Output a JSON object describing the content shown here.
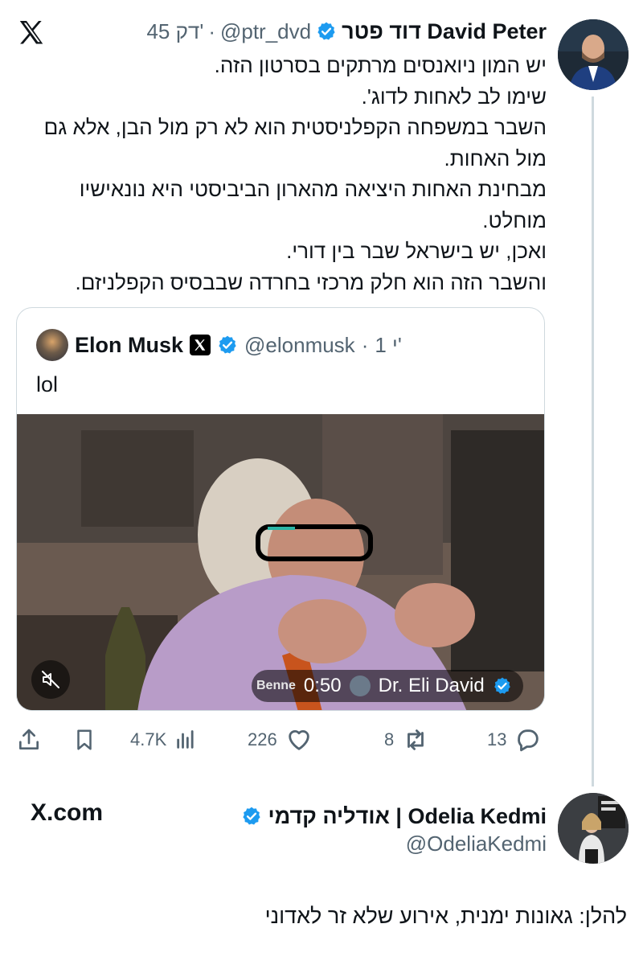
{
  "top_tweet": {
    "author_name": "דוד פטר David Peter",
    "handle": "@ptr_dvd",
    "separator": "·",
    "time": "45 דק'",
    "lines": [
      "יש המון ניואנסים מרתקים בסרטון הזה.",
      "שימו לב לאחות לדוג'.",
      "השבר במשפחה הקפלניסטית הוא לא רק מול הבן, אלא גם מול האחות.",
      "מבחינת  האחות היציאה מהארון הביביסטי היא נונאישיו מוחלט.",
      "ואכן, יש בישראל שבר בין דורי.",
      "והשבר הזה הוא חלק מרכזי בחרדה שבבסיס הקפלניזם."
    ]
  },
  "quoted_tweet": {
    "author_name": "Elon Musk",
    "handle": "@elonmusk",
    "separator": "·",
    "time": "1 י'",
    "text": "lol",
    "video": {
      "overlay_name_fragment": "Benne",
      "duration": "0:50",
      "credit": "Dr. Eli David"
    }
  },
  "actions": {
    "views": "4.7K",
    "likes": "226",
    "reposts": "8",
    "replies": "13"
  },
  "second_tweet": {
    "author_name": "אודליה קדמי | Odelia Kedmi",
    "handle": "@OdeliaKedmi",
    "text": "להלן: גאונות ימנית, אירוע שלא זר לאדוני"
  },
  "footer": {
    "site": "X.com"
  },
  "colors": {
    "verified": "#1d9bf0",
    "secondary_text": "#536471",
    "border": "#cfd9de"
  }
}
